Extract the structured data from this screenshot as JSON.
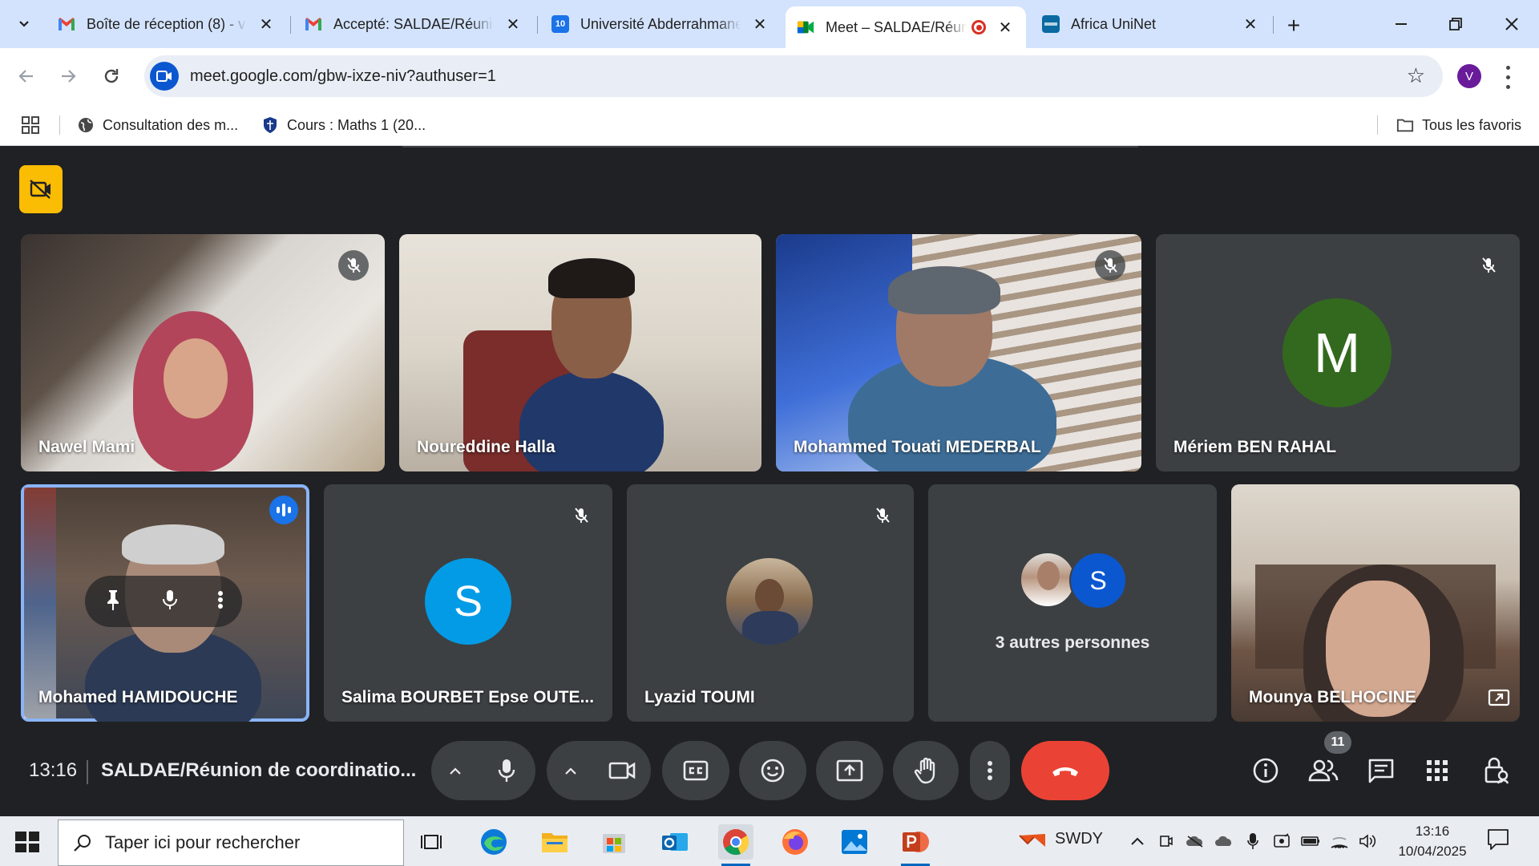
{
  "browser": {
    "tabs": [
      {
        "label": "Boîte de réception (8) - v",
        "favicon": "gmail-icon",
        "active": false
      },
      {
        "label": "Accepté: SALDAE/Réunion",
        "favicon": "gmail-icon",
        "active": false
      },
      {
        "label": "Université Abderrahmane",
        "favicon": "calendar-icon",
        "active": false
      },
      {
        "label": "Meet – SALDAE/Réun",
        "favicon": "meet-icon",
        "active": true
      },
      {
        "label": "Africa UniNet",
        "favicon": "uninet-icon",
        "active": false
      }
    ],
    "new_tab": "+",
    "url": "meet.google.com/gbw-ixze-niv?authuser=1",
    "profile_initial": "V",
    "bookmarks": [
      {
        "label": "Consultation des m..."
      },
      {
        "label": "Cours : Maths 1 (20..."
      }
    ],
    "all_bookmarks": "Tous les favoris",
    "calendar_favicon_text": "10"
  },
  "meet": {
    "participants": [
      {
        "name": "Nawel Mami",
        "muted": true,
        "video": true
      },
      {
        "name": "Noureddine Halla",
        "muted": false,
        "video": true
      },
      {
        "name": "Mohammed Touati MEDERBAL",
        "muted": true,
        "video": true
      },
      {
        "name": "Mériem BEN RAHAL",
        "muted": true,
        "video": false,
        "initial": "M",
        "color": "#33691e"
      },
      {
        "name": "Mohamed HAMIDOUCHE",
        "muted": false,
        "video": true,
        "speaking": true
      },
      {
        "name": "Salima BOURBET Epse OUTE...",
        "muted": true,
        "video": false,
        "initial": "S",
        "color": "#039be5"
      },
      {
        "name": "Lyazid TOUMI",
        "muted": true,
        "video": false
      },
      {
        "others_label": "3 autres personnes",
        "initial": "S",
        "color": "#0b57d0"
      },
      {
        "name": "Mounya BELHOCINE",
        "muted": false,
        "video": true
      }
    ],
    "time": "13:16",
    "meeting_title": "SALDAE/Réunion de coordinatio...",
    "participant_count": "11"
  },
  "taskbar": {
    "search_placeholder": "Taper ici pour rechercher",
    "swdy_label": "SWDY",
    "time": "13:16",
    "date": "10/04/2025"
  },
  "colors": {
    "meet_bg": "#202124",
    "tile_bg": "#3c4043",
    "end_call": "#ea4335",
    "active_speaker": "#8ab4f8",
    "host_badge": "#fbbc04"
  }
}
